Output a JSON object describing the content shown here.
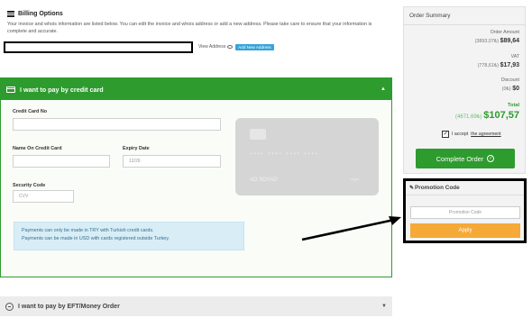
{
  "billing": {
    "title": "Billing Options",
    "description": "Your invoice and whois information are listed below. You can edit the invoice and whois address or add a new address. Please take care to ensure that your information is complete and accurate.",
    "view_address": "View Address",
    "add_address": "Add New Address"
  },
  "credit_card": {
    "header": "I want to pay by credit card",
    "card_no_label": "Credit Card No",
    "name_label": "Name On Credit Card",
    "expiry_label": "Expiry Date",
    "expiry_placeholder": "12/26",
    "security_label": "Security Code",
    "security_placeholder": "CVV",
    "card_number_mask": "**** **** **** ****",
    "card_name": "AD  SOYAD",
    "card_expiry_mask": "**/**",
    "info_line1": "Payments can only be made in TRY with Turkish credit cards.",
    "info_line2": "Payments can be made in USD with cards registered outside Turkey."
  },
  "eft": {
    "header": "I want to pay by EFT/Money Order"
  },
  "summary": {
    "title": "Order Summary",
    "order_amount_label": "Order Amount",
    "order_amount_try": "(3893,07₺)",
    "order_amount_usd": "$89,64",
    "vat_label": "VAT",
    "vat_try": "(778,61₺)",
    "vat_usd": "$17,93",
    "discount_label": "Discount",
    "discount_try": "(0₺)",
    "discount_usd": "$0",
    "total_label": "Total",
    "total_try": "(4671,69₺)",
    "total_usd": "$107,57",
    "accept_text": "I accept",
    "agreement_link": "the agreement",
    "complete_button": "Complete Order"
  },
  "promo": {
    "title": "Promotion Code",
    "placeholder": "Promotion Code",
    "apply_button": "Apply"
  },
  "colors": {
    "green": "#2e9b2e",
    "orange": "#f5a937",
    "blue_info": "#d9edf7"
  }
}
